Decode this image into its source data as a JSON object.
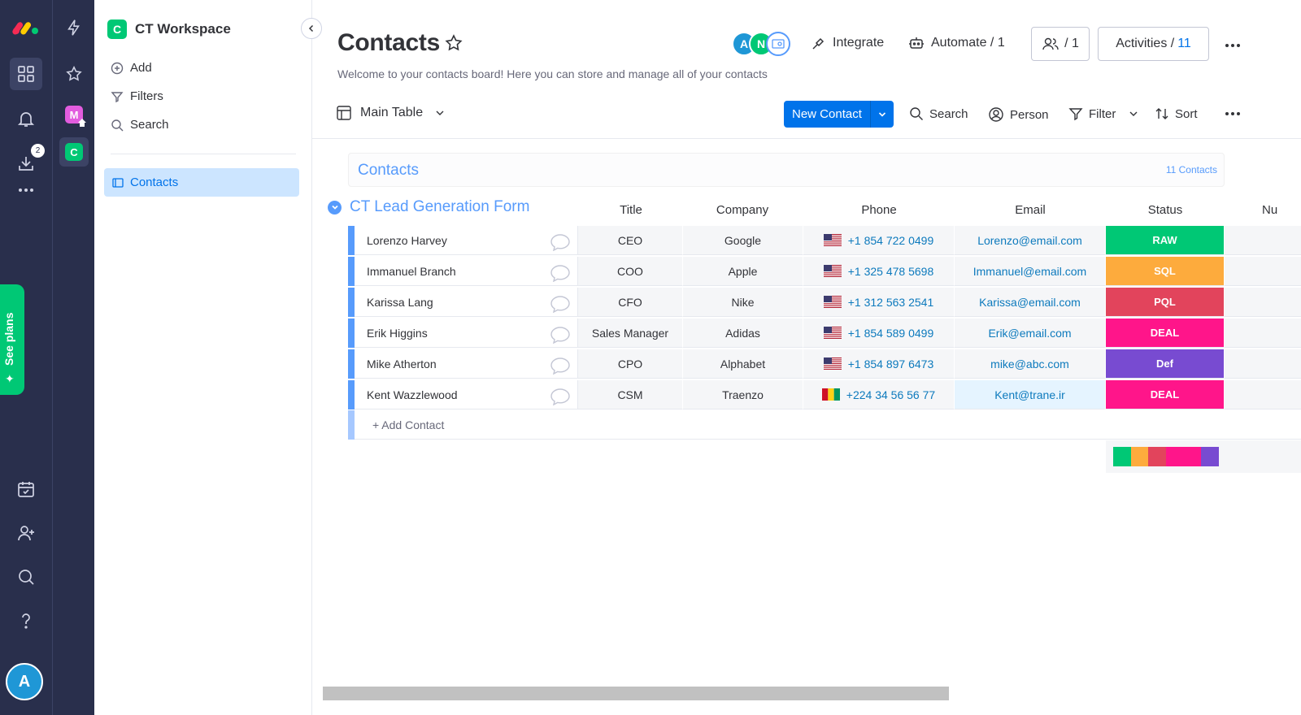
{
  "rail": {
    "items": [
      {
        "name": "logo",
        "icon": "monday-logo"
      },
      {
        "name": "apps",
        "icon": "grid-icon"
      },
      {
        "name": "notifications",
        "icon": "bell-icon"
      },
      {
        "name": "inbox",
        "icon": "download-icon",
        "badge": "2"
      },
      {
        "name": "more",
        "icon": "dots-icon"
      }
    ],
    "bottom": [
      "calendar-check-icon",
      "invite-user-icon",
      "search-icon",
      "help-icon"
    ],
    "avatar_letter": "A",
    "see_plans": "See plans"
  },
  "ws_rail": {
    "tiles": [
      {
        "letter": "M",
        "color": "#e25cde"
      },
      {
        "letter": "C",
        "color": "#00c875"
      }
    ]
  },
  "panel": {
    "workspace_letter": "C",
    "workspace_name": "CT Workspace",
    "actions": [
      "Add",
      "Filters",
      "Search"
    ],
    "board": "Contacts"
  },
  "header": {
    "title": "Contacts",
    "subtitle": "Welcome to your contacts board! Here you can store and manage all of your contacts",
    "avatars": [
      {
        "letter": "A",
        "color": "#1f97d6"
      },
      {
        "letter": "N",
        "color": "#00c875"
      }
    ],
    "integrate": "Integrate",
    "automate": "Automate / 1",
    "members": "/ 1",
    "activities_label": "Activities /",
    "activities_count": "11"
  },
  "toolbar": {
    "view": "Main Table",
    "new_item": "New Contact",
    "search": "Search",
    "person": "Person",
    "filter": "Filter",
    "sort": "Sort"
  },
  "groups": [
    {
      "title": "Contacts",
      "count": "11 Contacts"
    },
    {
      "title": "CT Lead Generation Form"
    }
  ],
  "columns": [
    "Title",
    "Company",
    "Phone",
    "Email",
    "Status",
    "Nu"
  ],
  "rows": [
    {
      "name": "Lorenzo Harvey",
      "title": "CEO",
      "company": "Google",
      "flag": "us",
      "phone": "+1 854 722 0499",
      "email": "Lorenzo@email.com",
      "status": "RAW",
      "status_color": "#00c875"
    },
    {
      "name": "Immanuel Branch",
      "title": "COO",
      "company": "Apple",
      "flag": "us",
      "phone": "+1 325 478 5698",
      "email": "Immanuel@email.com",
      "status": "SQL",
      "status_color": "#fdab3d"
    },
    {
      "name": "Karissa Lang",
      "title": "CFO",
      "company": "Nike",
      "flag": "us",
      "phone": "+1 312 563 2541",
      "email": "Karissa@email.com",
      "status": "PQL",
      "status_color": "#e2445c"
    },
    {
      "name": "Erik Higgins",
      "title": "Sales Manager",
      "company": "Adidas",
      "flag": "us",
      "phone": "+1 854 589 0499",
      "email": "Erik@email.com",
      "status": "DEAL",
      "status_color": "#ff158a"
    },
    {
      "name": "Mike Atherton",
      "title": "CPO",
      "company": "Alphabet",
      "flag": "us",
      "phone": "+1 854 897 6473",
      "email": "mike@abc.com",
      "status": "Def",
      "status_color": "#784bd1"
    },
    {
      "name": "Kent Wazzlewood",
      "title": "CSM",
      "company": "Traenzo",
      "flag": "gn",
      "phone": "+224 34 56 56 77",
      "email": "Kent@trane.ir",
      "status": "DEAL",
      "status_color": "#ff158a"
    }
  ],
  "add_row": "+ Add Contact",
  "status_summary": [
    {
      "color": "#00c875",
      "fraction": 0.167
    },
    {
      "color": "#fdab3d",
      "fraction": 0.167
    },
    {
      "color": "#e2445c",
      "fraction": 0.167
    },
    {
      "color": "#ff158a",
      "fraction": 0.333
    },
    {
      "color": "#784bd1",
      "fraction": 0.167
    }
  ]
}
